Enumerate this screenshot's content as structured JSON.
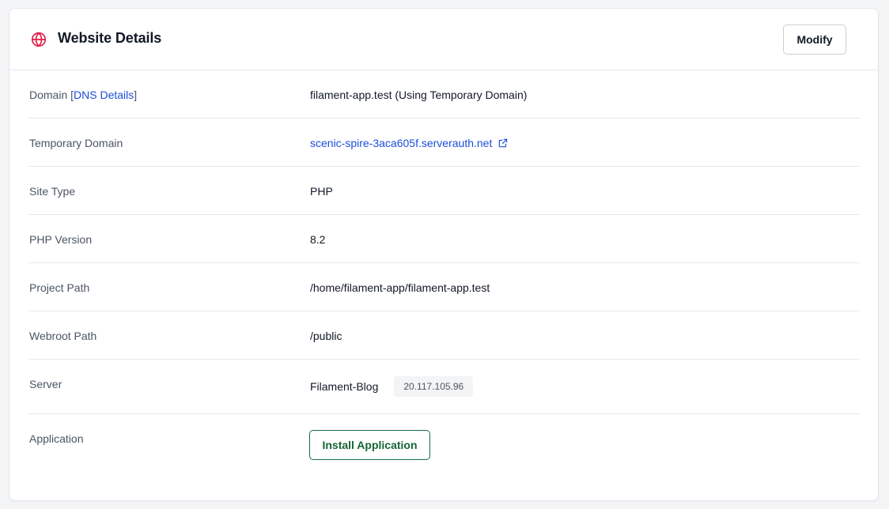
{
  "header": {
    "title": "Website Details",
    "icon": "globe-icon",
    "modify_label": "Modify"
  },
  "colors": {
    "accent_red": "#e11d48",
    "link_blue": "#1d4ed8",
    "install_green": "#166534"
  },
  "details": {
    "domain": {
      "label_prefix": "Domain",
      "bracket_open": "[",
      "dns_link": "DNS Details",
      "bracket_close": "]",
      "value": "filament-app.test (Using Temporary Domain)"
    },
    "temporary_domain": {
      "label": "Temporary Domain",
      "value": "scenic-spire-3aca605f.serverauth.net",
      "icon": "external-link-icon"
    },
    "site_type": {
      "label": "Site Type",
      "value": "PHP"
    },
    "php_version": {
      "label": "PHP Version",
      "value": "8.2"
    },
    "project_path": {
      "label": "Project Path",
      "value": "/home/filament-app/filament-app.test"
    },
    "webroot_path": {
      "label": "Webroot Path",
      "value": "/public"
    },
    "server": {
      "label": "Server",
      "name": "Filament-Blog",
      "ip": "20.117.105.96"
    },
    "application": {
      "label": "Application",
      "button_label": "Install Application"
    }
  }
}
